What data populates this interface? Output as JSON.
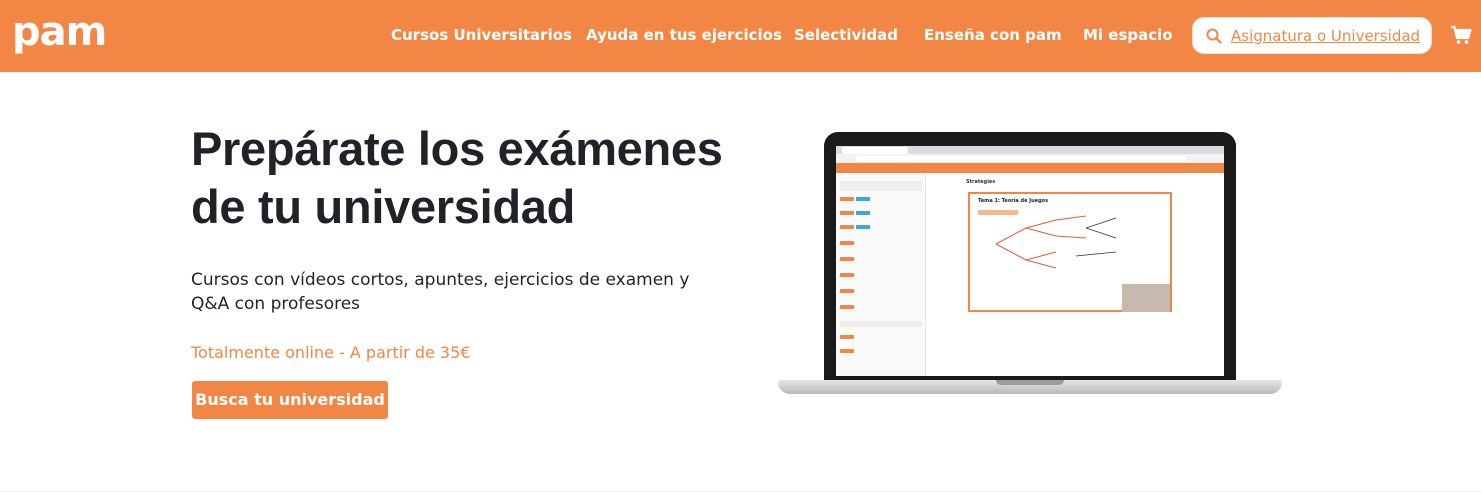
{
  "header": {
    "logo": "pam",
    "nav": [
      {
        "label": "Cursos Universitarios"
      },
      {
        "label": "Ayuda en tus ejercicios"
      },
      {
        "label": "Selectividad"
      },
      {
        "label": "Enseña con pam"
      },
      {
        "label": "Mi espacio"
      }
    ],
    "search": {
      "placeholder": "Asignatura o Universidad",
      "value": "",
      "icon": "search-icon"
    },
    "cart": {
      "icon": "cart-icon"
    }
  },
  "hero": {
    "title_line1": "Prepárate los exámenes",
    "title_line2": "de tu universidad",
    "subtitle": "Cursos con vídeos cortos, apuntes, ejercicios de examen y Q&A con profesores",
    "price": "Totalmente online - A partir de 35€",
    "cta": "Busca tu universidad"
  },
  "colors": {
    "brand": "#f28745",
    "text": "#1f2328",
    "background": "#ffffff"
  },
  "laptop_screen": {
    "title": "Strategies",
    "slide_title": "Tema 1: Teoría de Juegos"
  }
}
